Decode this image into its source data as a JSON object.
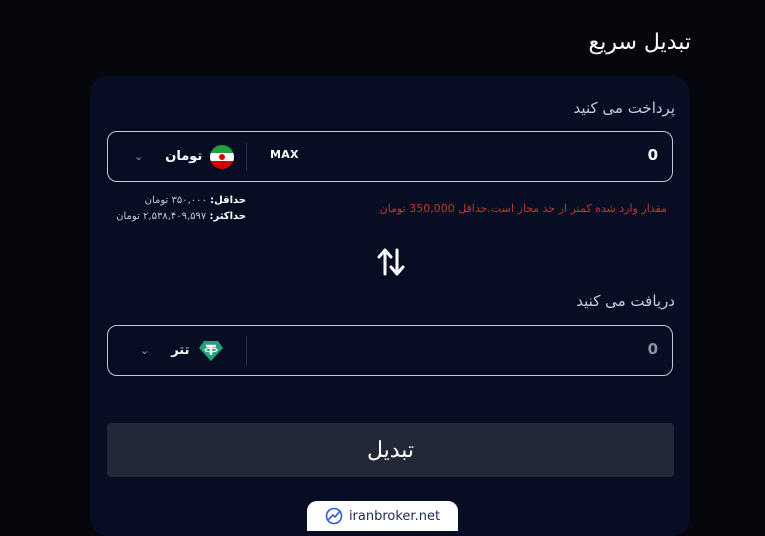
{
  "header": {
    "title": "تبدیل سریع"
  },
  "pay": {
    "label": "پرداخت می کنید",
    "value": "0",
    "max_label": "MAX",
    "currency": {
      "name": "تومان",
      "icon": "iran-flag-icon"
    },
    "limits": {
      "min_label": "حداقل:",
      "min_value": "۳۵۰,۰۰۰ تومان",
      "max_label": "حداکثر:",
      "max_value": "۲,۵۳۸,۴۰۹,۵۹۷ تومان"
    },
    "error": "مقدار وارد شده کمتر از حد مجاز است.حداقل 350,000 تومان"
  },
  "receive": {
    "label": "دریافت می کنید",
    "value": "0",
    "currency": {
      "name": "تتر",
      "icon": "tether-icon"
    }
  },
  "convert_button": "تبدیل",
  "watermark": "iranbroker.net",
  "colors": {
    "background": "#05070d",
    "card": "#070d22",
    "button": "#232838",
    "error": "#c0392b",
    "tether": "#26a17b"
  }
}
